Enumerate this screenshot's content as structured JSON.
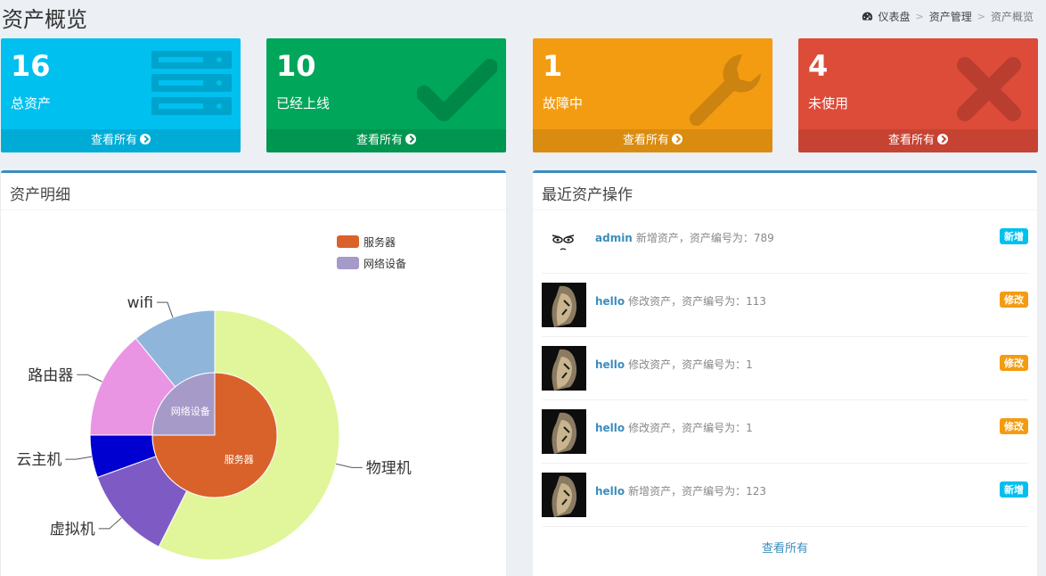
{
  "header": {
    "title": "资产概览",
    "breadcrumb": [
      "仪表盘",
      "资产管理",
      "资产概览"
    ]
  },
  "stat_boxes": [
    {
      "value": "16",
      "label": "总资产",
      "link": "查看所有",
      "color": "#00c0ef",
      "icon": "server-icon"
    },
    {
      "value": "10",
      "label": "已经上线",
      "link": "查看所有",
      "color": "#00a65a",
      "icon": "check-icon"
    },
    {
      "value": "1",
      "label": "故障中",
      "link": "查看所有",
      "color": "#f39c12",
      "icon": "wrench-icon"
    },
    {
      "value": "4",
      "label": "未使用",
      "link": "查看所有",
      "color": "#dd4b39",
      "icon": "x-icon"
    }
  ],
  "detail_panel": {
    "title": "资产明细"
  },
  "recent_panel": {
    "title": "最近资产操作",
    "items": [
      {
        "user": "admin",
        "action": "新增资产，资产编号为：789",
        "badge": "新增",
        "type": "add",
        "avatar": "cartoon-face-avatar"
      },
      {
        "user": "hello",
        "action": "修改资产，资产编号为：113",
        "badge": "修改",
        "type": "mod",
        "avatar": "dark-photo-avatar"
      },
      {
        "user": "hello",
        "action": "修改资产，资产编号为：1",
        "badge": "修改",
        "type": "mod",
        "avatar": "dark-photo-avatar"
      },
      {
        "user": "hello",
        "action": "修改资产，资产编号为：1",
        "badge": "修改",
        "type": "mod",
        "avatar": "dark-photo-avatar"
      },
      {
        "user": "hello",
        "action": "新增资产，资产编号为：123",
        "badge": "新增",
        "type": "add",
        "avatar": "dark-photo-avatar"
      }
    ],
    "view_all": "查看所有"
  },
  "chart_data": {
    "type": "pie",
    "legend": [
      "服务器",
      "网络设备"
    ],
    "legend_position": "top-right",
    "inner": [
      {
        "name": "服务器",
        "value": 0.75,
        "color": "#d9622b"
      },
      {
        "name": "网络设备",
        "value": 0.25,
        "color": "#a69ac8"
      }
    ],
    "outer": [
      {
        "name": "物理机",
        "value": 0.574,
        "color": "#e1f59b"
      },
      {
        "name": "虚拟机",
        "value": 0.121,
        "color": "#7e5bc4"
      },
      {
        "name": "云主机",
        "value": 0.055,
        "color": "#0000d0"
      },
      {
        "name": "路由器",
        "value": 0.141,
        "color": "#ea94e4"
      },
      {
        "name": "wifi",
        "value": 0.109,
        "color": "#8fb5da"
      }
    ]
  }
}
